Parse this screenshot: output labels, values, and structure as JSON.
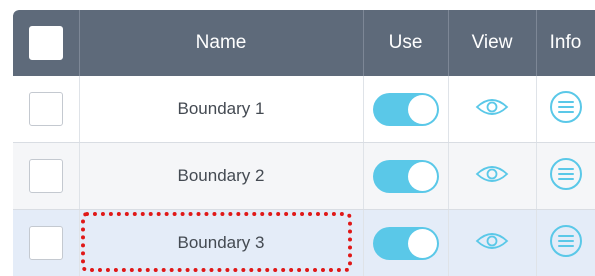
{
  "header": {
    "select_all_checked": false,
    "columns": {
      "name": "Name",
      "use": "Use",
      "view": "View",
      "info": "Info"
    }
  },
  "rows": [
    {
      "name": "Boundary 1",
      "checked": false,
      "use_enabled": true,
      "selected": false
    },
    {
      "name": "Boundary 2",
      "checked": false,
      "use_enabled": true,
      "selected": false
    },
    {
      "name": "Boundary 3",
      "checked": false,
      "use_enabled": true,
      "selected": true
    }
  ],
  "icons": {
    "view": "eye-icon",
    "info": "menu-circle-icon"
  },
  "colors": {
    "header_bg": "#5e6a7a",
    "toggle_on": "#5ac8e8",
    "icon_accent": "#5ac8e8",
    "selected_row_bg": "#e4ecf8",
    "highlight_border": "#e01818"
  }
}
